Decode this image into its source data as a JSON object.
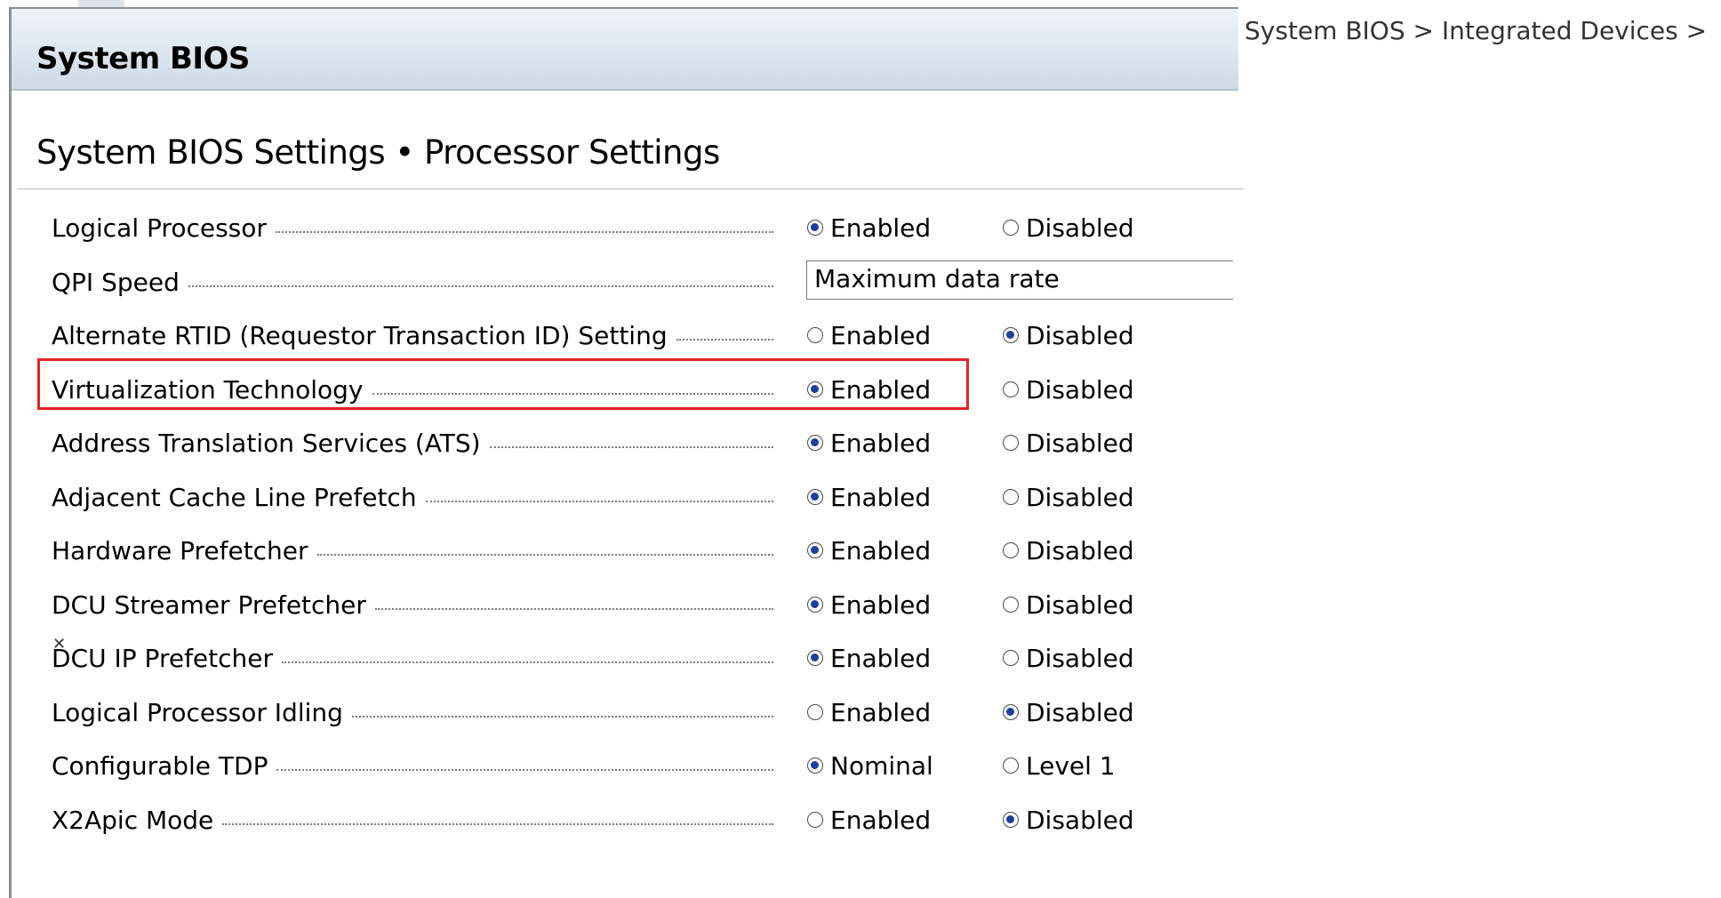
{
  "breadcrumb": "System BIOS > Integrated Devices >",
  "panel": {
    "title": "System BIOS"
  },
  "section": {
    "title": "System BIOS Settings • Processor Settings"
  },
  "colors": {
    "highlight": "#e52222",
    "radio_fill": "#1d3f9e"
  },
  "settings": [
    {
      "label": "Logical Processor",
      "options": [
        "Enabled",
        "Disabled"
      ],
      "selected": 0
    },
    {
      "label": "QPI Speed",
      "value": "Maximum data rate"
    },
    {
      "label": "Alternate RTID (Requestor Transaction ID) Setting",
      "options": [
        "Enabled",
        "Disabled"
      ],
      "selected": 1
    },
    {
      "label": "Virtualization Technology",
      "options": [
        "Enabled",
        "Disabled"
      ],
      "selected": 0
    },
    {
      "label": "Address Translation Services (ATS)",
      "options": [
        "Enabled",
        "Disabled"
      ],
      "selected": 0
    },
    {
      "label": "Adjacent Cache Line Prefetch",
      "options": [
        "Enabled",
        "Disabled"
      ],
      "selected": 0
    },
    {
      "label": "Hardware Prefetcher",
      "options": [
        "Enabled",
        "Disabled"
      ],
      "selected": 0
    },
    {
      "label": "DCU Streamer Prefetcher",
      "options": [
        "Enabled",
        "Disabled"
      ],
      "selected": 0
    },
    {
      "label": "DCU IP Prefetcher",
      "options": [
        "Enabled",
        "Disabled"
      ],
      "selected": 0
    },
    {
      "label": "Logical Processor Idling",
      "options": [
        "Enabled",
        "Disabled"
      ],
      "selected": 1
    },
    {
      "label": "Configurable TDP",
      "options": [
        "Nominal",
        "Level 1"
      ],
      "selected": 0
    },
    {
      "label": "X2Apic Mode",
      "options": [
        "Enabled",
        "Disabled"
      ],
      "selected": 1
    }
  ]
}
